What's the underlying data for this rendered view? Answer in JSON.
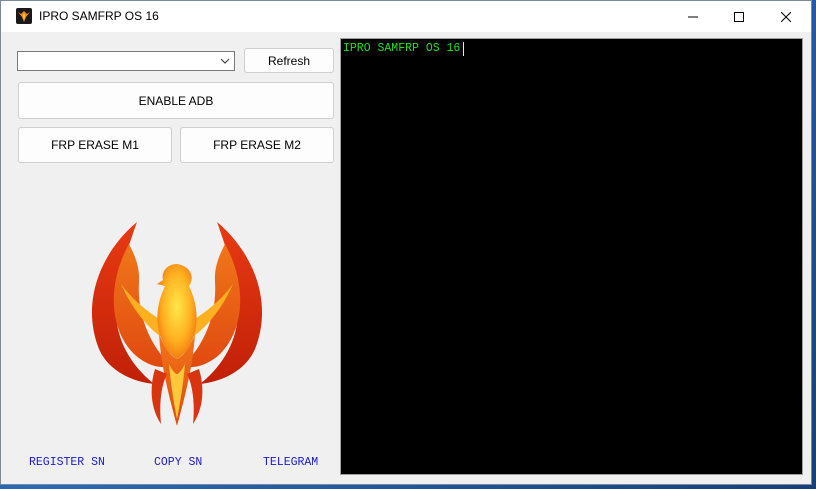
{
  "window": {
    "title": "IPRO SAMFRP OS 16",
    "icon": "phoenix-icon",
    "controls": [
      "minimize-icon",
      "maximize-icon",
      "close-icon"
    ]
  },
  "device_select": {
    "value": ""
  },
  "buttons": {
    "refresh": "Refresh",
    "enable_adb": "ENABLE ADB",
    "frp_erase_m1": "FRP ERASE M1",
    "frp_erase_m2": "FRP ERASE M2"
  },
  "logo": {
    "icon": "phoenix-logo"
  },
  "links": {
    "register_sn": "REGISTER SN",
    "copy_sn": "COPY SN",
    "telegram": "TELEGRAM"
  },
  "console": {
    "text": "IPRO SAMFRP OS 16"
  },
  "colors": {
    "console_bg": "#000000",
    "console_text": "#22e022",
    "link": "#1a1ad0",
    "window_bg": "#f0f0f0"
  }
}
